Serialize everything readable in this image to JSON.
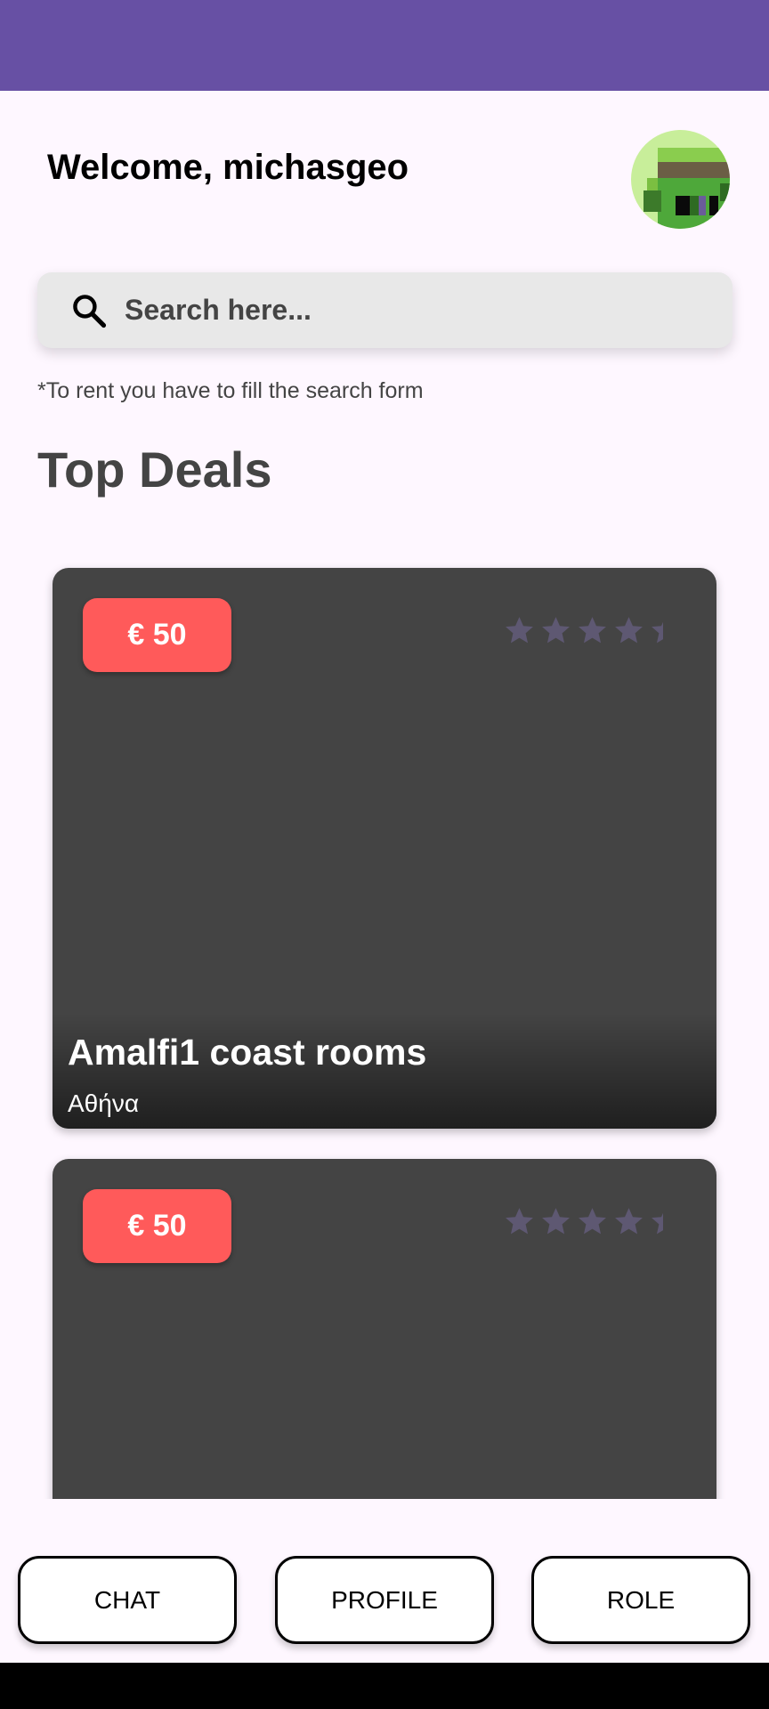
{
  "header": {
    "welcome_text": "Welcome, michasgeo"
  },
  "search": {
    "placeholder": "Search here...",
    "value": ""
  },
  "hint_text": "*To rent you have to fill the search form",
  "section_title": "Top Deals",
  "listings": [
    {
      "price": "€ 50",
      "rating": 4.5,
      "title": "Amalfi1 coast rooms",
      "location": "Αθήνα"
    },
    {
      "price": "€ 50",
      "rating": 4.5,
      "title": "",
      "location": ""
    }
  ],
  "bottom_nav": {
    "chat": "CHAT",
    "profile": "PROFILE",
    "role": "ROLE"
  },
  "colors": {
    "status_bar": "#6750A4",
    "price_badge": "#FF5A5A",
    "card_bg": "#444444",
    "star": "#5E5872"
  }
}
